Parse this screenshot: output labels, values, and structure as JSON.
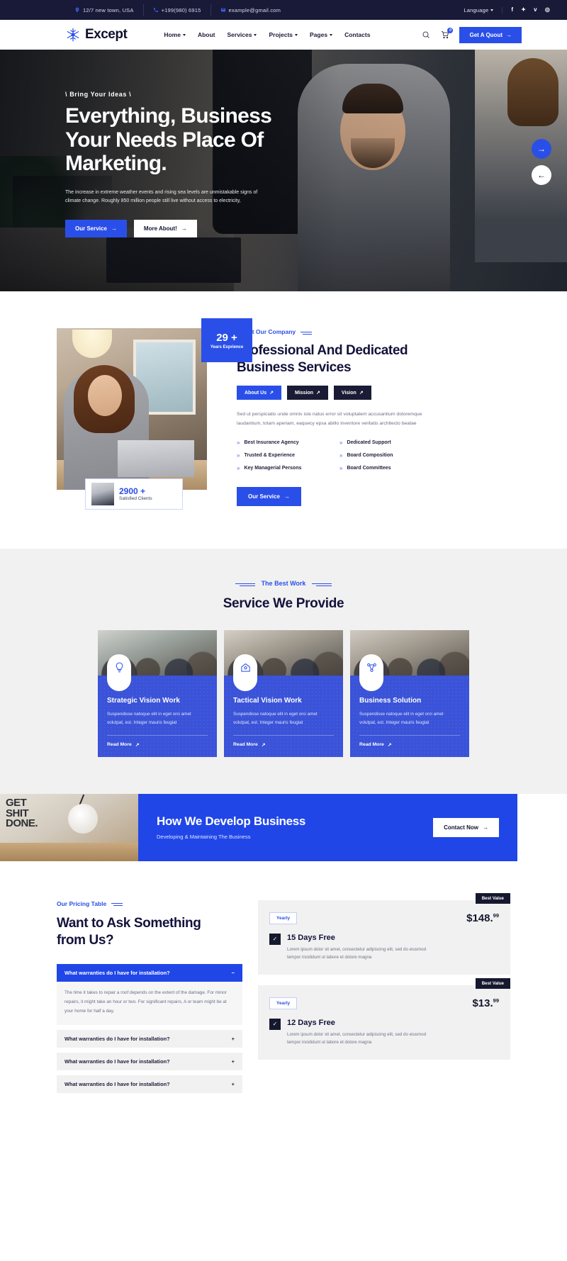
{
  "topbar": {
    "items": [
      {
        "icon": "location-pin-icon",
        "text": "12/7 new town, USA"
      },
      {
        "icon": "phone-icon",
        "text": "+199(980) 6915"
      },
      {
        "icon": "envelope-icon",
        "text": "example@gmail.com"
      }
    ],
    "language_label": "Language",
    "socials": [
      "f",
      "✦",
      "v",
      "◎"
    ]
  },
  "header": {
    "brand": "Except",
    "nav": [
      {
        "label": "Home",
        "caret": true
      },
      {
        "label": "About",
        "caret": false
      },
      {
        "label": "Services",
        "caret": true
      },
      {
        "label": "Projects",
        "caret": true
      },
      {
        "label": "Pages",
        "caret": true
      },
      {
        "label": "Contacts",
        "caret": false
      }
    ],
    "cart_count": "0",
    "quote_button": "Get A Quout"
  },
  "hero": {
    "eyebrow": "\\ Bring Your Ideas \\",
    "title_line1": "Everything, Business",
    "title_line2": "Your Needs Place Of",
    "title_line3": "Marketing.",
    "description": "The increase in extreme weather events and rising sea levels are unmistakable signs of climate change. Roughly 850 million people still live without access to electricity,",
    "primary_button": "Our Service",
    "secondary_button": "More About!",
    "next_arrow": "→",
    "prev_arrow": "←"
  },
  "about": {
    "years_number": "29 +",
    "years_label": "Years Exprience",
    "clients_number": "2900 +",
    "clients_label": "Satisfied Clients",
    "eyebrow": "About Our Company",
    "heading_line1": "Professional And Dedicated",
    "heading_line2": "Business Services",
    "pills": [
      {
        "label": "About Us",
        "active": true
      },
      {
        "label": "Mission",
        "active": false
      },
      {
        "label": "Vision",
        "active": false
      }
    ],
    "paragraph": "Sed ut perspiciatis unde omnis iste natus error sit voluptatem accusantium doloremque laudantium, totam aperiam, eaquecy epsa abillo inventore veritatis architecto beatae",
    "features_left": [
      "Best Insurance Agency",
      "Trusted & Experience",
      "Key Managerial Persons"
    ],
    "features_right": [
      "Dedicated Support",
      "Board Composition",
      "Board Committees"
    ],
    "service_button": "Our Service"
  },
  "services": {
    "eyebrow": "The Best Work",
    "title": "Service We Provide",
    "cards": [
      {
        "icon": "lightbulb-icon",
        "title": "Strategic Vision Work",
        "text": "Suspendisse natoque elit in eget orci amet volutpat, est. Integer mauris feugiat",
        "more": "Read More"
      },
      {
        "icon": "home-settings-icon",
        "title": "Tactical Vision Work",
        "text": "Suspendisse natoque elit in eget orci amet volutpat, est. Integer mauris feugiat",
        "more": "Read More"
      },
      {
        "icon": "network-chart-icon",
        "title": "Business Solution",
        "text": "Suspendisse natoque elit in eget orci amet volutpat, est. Integer mauris feugiat",
        "more": "Read More"
      }
    ]
  },
  "cta": {
    "photo_text_line1": "GET",
    "photo_text_line2": "SHIT",
    "photo_text_line3": "DONE.",
    "heading": "How We Develop Business",
    "subheading": "Developing & Maintaining The Business",
    "button": "Contact Now"
  },
  "faq": {
    "eyebrow": "Our Pricing Table",
    "heading_line1": "Want to Ask Something",
    "heading_line2": "from Us?",
    "items": [
      {
        "question": "What warranties do I have for installation?",
        "open": true,
        "toggle": "−",
        "answer": "The time it takes to repair a roof depends on the extent of the damage. For minor repairs, it might take an hour or two. For significant repairs, A or team might be at your home for half a day."
      },
      {
        "question": "What warranties do I have for installation?",
        "open": false,
        "toggle": "+",
        "answer": ""
      },
      {
        "question": "What warranties do I have for installation?",
        "open": false,
        "toggle": "+",
        "answer": ""
      },
      {
        "question": "What warranties do I have for installation?",
        "open": false,
        "toggle": "+",
        "answer": ""
      }
    ]
  },
  "pricing": {
    "cards": [
      {
        "badge": "Best Value",
        "tag": "Yearly",
        "price_main": "$148.",
        "price_cents": "99",
        "title": "15 Days Free",
        "text": "Lorem ipsum dolor sit amet, consectetur adipiscing elit, sed do eiusmod tempor incididunt ut labore et dolore magna",
        "checked": true,
        "check_glyph": "✓"
      },
      {
        "badge": "Best Value",
        "tag": "Yearly",
        "price_main": "$13.",
        "price_cents": "99",
        "title": "12 Days Free",
        "text": "Lorem ipsum dolor sit amet, consectetur adipiscing elit, sed do eiusmod tempor incididunt ut labore et dolore magna",
        "checked": true,
        "check_glyph": "✓"
      }
    ]
  },
  "colors": {
    "brand_blue": "#2a4fe8",
    "dark_navy": "#16182f",
    "light_grey": "#f1f1f1"
  }
}
